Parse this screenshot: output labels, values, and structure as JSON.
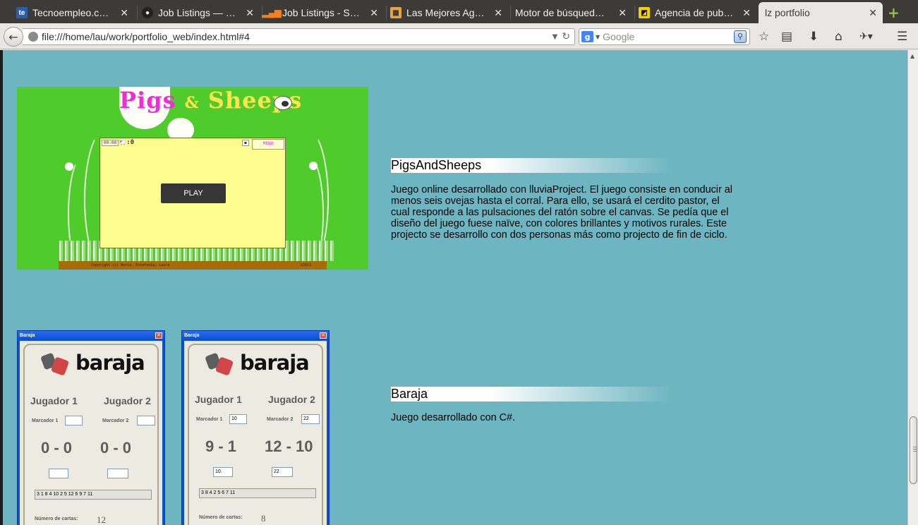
{
  "browser": {
    "tabs": [
      {
        "title": "Tecnoempleo.c…",
        "favicon": "te",
        "favicon_color": "#2a5db0"
      },
      {
        "title": "Job Listings — …",
        "favicon": "github-icon",
        "favicon_color": "#222222"
      },
      {
        "title": "Job Listings - S…",
        "favicon": "stackoverflow-icon",
        "favicon_color": "#f48024"
      },
      {
        "title": "Las Mejores Ag…",
        "favicon": "page-icon",
        "favicon_color": "#e8a33d"
      },
      {
        "title": "Motor de búsqued…",
        "favicon": "",
        "favicon_color": ""
      },
      {
        "title": "Agencia de pub…",
        "favicon": "agency-icon",
        "favicon_color": "#f5d000"
      },
      {
        "title": "lz portfolio",
        "favicon": "",
        "favicon_color": "",
        "active": true
      }
    ],
    "new_tab_glyph": "+",
    "url": "file:///home/lau/work/portfolio_web/index.html#4",
    "search": {
      "engine": "g",
      "placeholder": "Google"
    }
  },
  "projects": [
    {
      "heading": "PigsAndSheeps",
      "description": "Juego online desarrollado con lluviaProject. El juego consiste en conducir al menos seis ovejas hasta el corral. Para ello, se usará el cerdito pastor, el cual responde a las pulsaciones del ratón sobre el canvas. Se pedía que el diseño del juego fuese naïve, con colores brillantes y motivos rurales. Este projecto se desarrollo con dos personas más como projecto de fin de ciclo.",
      "screenshot": {
        "title_pigs": "Pigs",
        "title_amp": "&",
        "title_sheeps": "Sheeps",
        "timer": "00:00",
        "sheep_count": ":0",
        "menu": "MENU",
        "play": "PLAY",
        "copyright": "Copyright (c) María, Estefanía, Laura",
        "year": "©2013",
        "colors": {
          "bg": "#4fcb2c",
          "title": "#f02dd4",
          "board": "#fdfd8f",
          "ground": "#a96a08"
        }
      }
    },
    {
      "heading": "Baraja",
      "description": "Juego desarrollado con C#.",
      "screenshots": [
        {
          "window_title": "Baraja",
          "brand": "baraja",
          "player1": "Jugador 1",
          "player2": "Jugador 2",
          "marker1_label": "Marcador 1",
          "marker2_label": "Marcador 2",
          "marker1_value": "",
          "marker2_value": "",
          "score1": "0 - 0",
          "score2": "0 - 0",
          "box1": "",
          "box2": "",
          "sequence": "3 1 8 4 10 2 5 12 6 9 7 11",
          "cards_label": "Número de cartas:",
          "cards_value": "12"
        },
        {
          "window_title": "Baraja",
          "brand": "baraja",
          "player1": "Jugador 1",
          "player2": "Jugador 2",
          "marker1_label": "Marcador 1",
          "marker2_label": "Marcador 2",
          "marker1_value": "10",
          "marker2_value": "22",
          "score1": "9 - 1",
          "score2": "12 - 10",
          "box1": "10.",
          "box2": "22",
          "sequence": "3 8 4 2 5 6 7 11",
          "cards_label": "Número de cartas:",
          "cards_value": "8"
        }
      ]
    }
  ],
  "colors": {
    "page_bg": "#6db5c0",
    "chrome": "#e9e7e3",
    "tabstrip": "#3c3b37"
  }
}
